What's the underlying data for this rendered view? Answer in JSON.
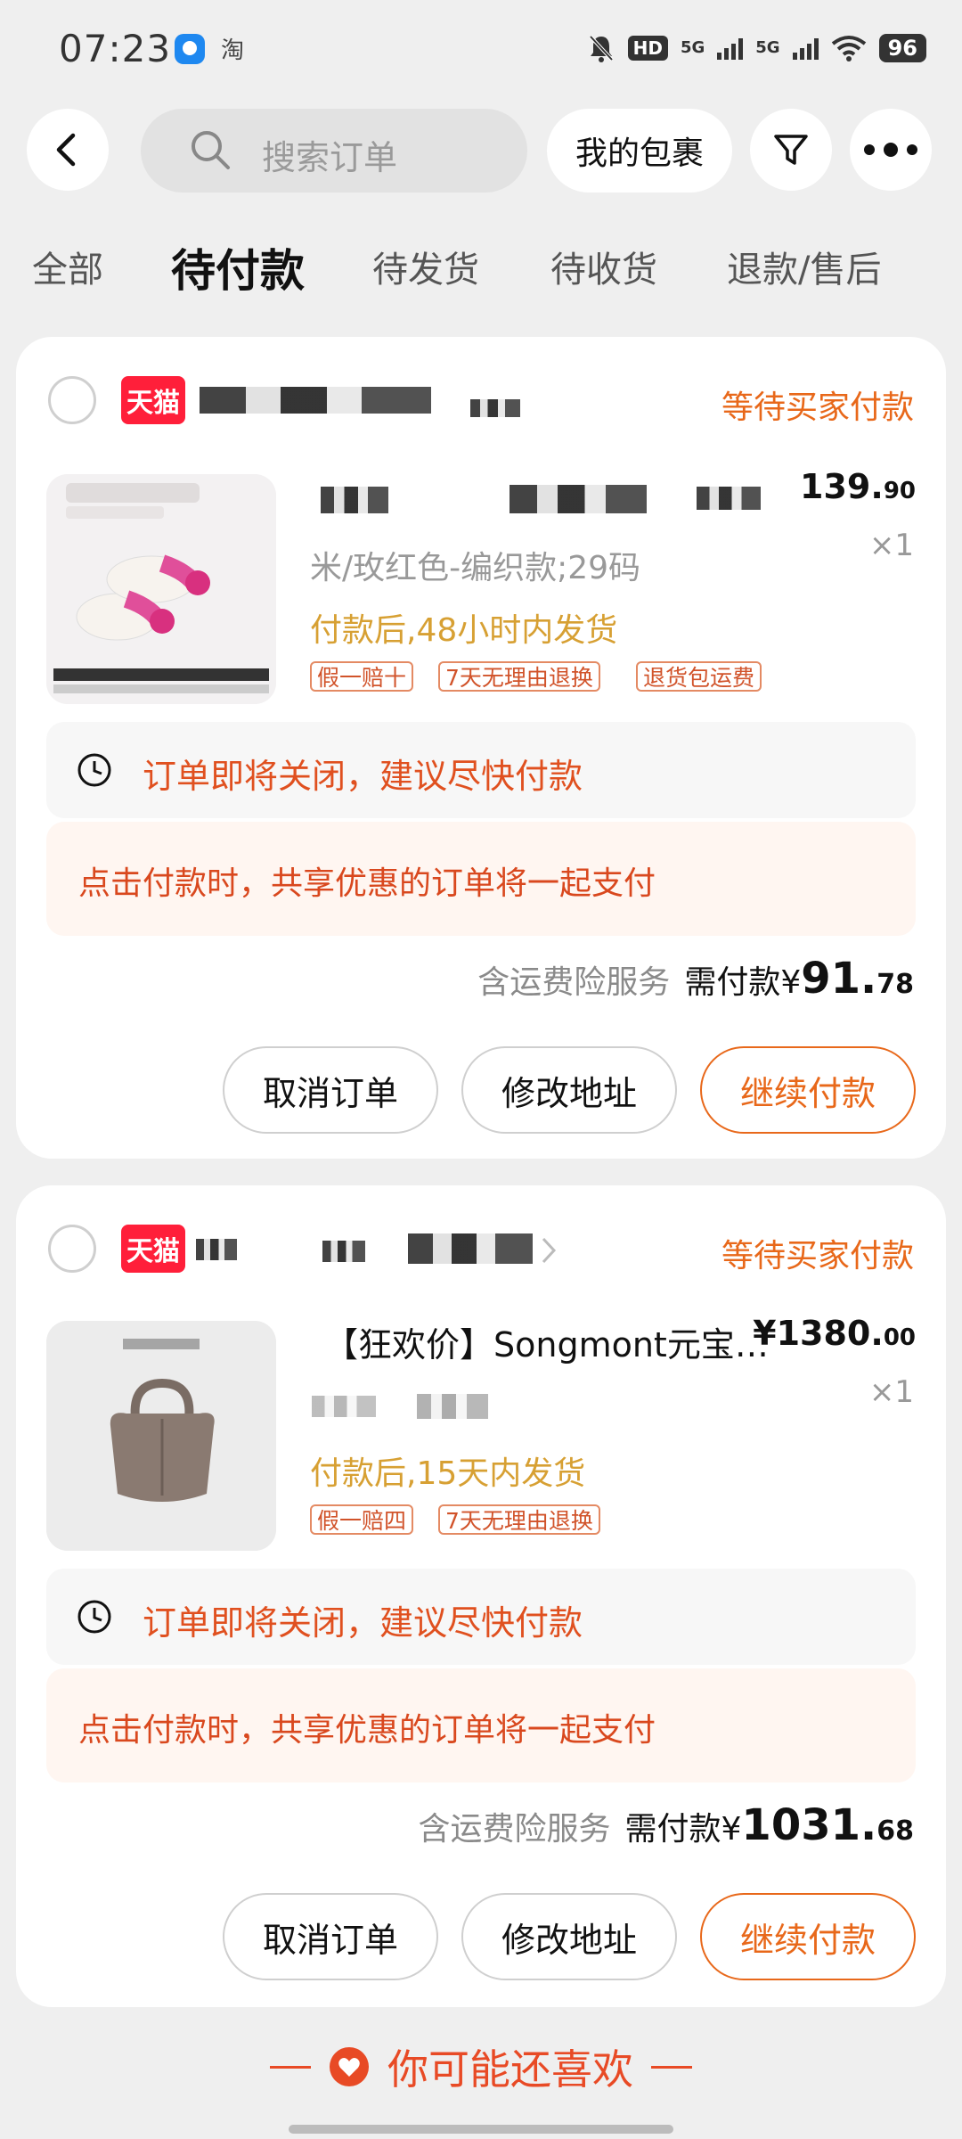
{
  "status_bar": {
    "time": "07:23",
    "app2": "淘",
    "network1": "5G",
    "network2": "5G",
    "hd": "HD",
    "battery": "96"
  },
  "header": {
    "search_placeholder": "搜索订单",
    "packages_label": "我的包裹"
  },
  "tabs": [
    {
      "label": "全部",
      "active": false
    },
    {
      "label": "待付款",
      "active": true
    },
    {
      "label": "待发货",
      "active": false
    },
    {
      "label": "待收货",
      "active": false
    },
    {
      "label": "退款/售后",
      "active": false
    }
  ],
  "orders": [
    {
      "store_badge": "天猫",
      "status": "等待买家付款",
      "product_title": "",
      "price_int": "139.",
      "price_dec": "90",
      "quantity": "×1",
      "spec": "米/玫红色-编织款;29码",
      "ship_note": "付款后,48小时内发货",
      "tags": [
        "假一赔十",
        "7天无理由退换",
        "退货包运费"
      ],
      "warning": "订单即将关闭，建议尽快付款",
      "share_note": "点击付款时，共享优惠的订单将一起支付",
      "service": "含运费险服务",
      "due_label": "需付款¥",
      "due_int": "91.",
      "due_dec": "78",
      "buttons": {
        "cancel": "取消订单",
        "modify": "修改地址",
        "pay": "继续付款"
      }
    },
    {
      "store_badge": "天猫",
      "status": "等待买家付款",
      "product_title": "【狂欢价】Songmont元宝…",
      "price_int": "¥1380.",
      "price_dec": "00",
      "quantity": "×1",
      "spec": "",
      "ship_note": "付款后,15天内发货",
      "tags": [
        "假一赔四",
        "7天无理由退换"
      ],
      "warning": "订单即将关闭，建议尽快付款",
      "share_note": "点击付款时，共享优惠的订单将一起支付",
      "service": "含运费险服务",
      "due_label": "需付款¥",
      "due_int": "1031.",
      "due_dec": "68",
      "buttons": {
        "cancel": "取消订单",
        "modify": "修改地址",
        "pay": "继续付款"
      }
    }
  ],
  "recommend": {
    "label": "你可能还喜欢"
  },
  "colors": {
    "accent": "#e8681a",
    "tmall": "#ff1f3a",
    "ship": "#d7a033"
  }
}
